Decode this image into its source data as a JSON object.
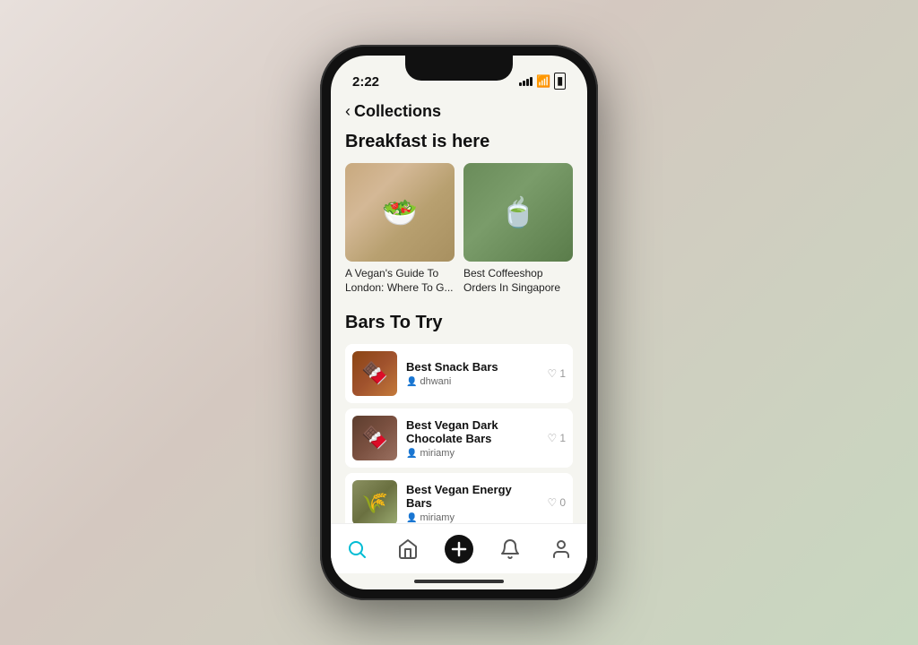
{
  "phone": {
    "status": {
      "time": "2:22",
      "signal": true,
      "wifi": true,
      "battery": true
    },
    "header": {
      "back_label": "Collections",
      "back_icon": "‹"
    },
    "sections": [
      {
        "id": "breakfast",
        "title": "Breakfast is here",
        "type": "grid",
        "items": [
          {
            "id": "vegan-london",
            "image_type": "vegan",
            "label": "A Vegan's Guide To London: Where To G..."
          },
          {
            "id": "coffeeshop-sg",
            "image_type": "coffee",
            "label": "Best Coffeeshop Orders In Singapore"
          }
        ]
      },
      {
        "id": "bars",
        "title": "Bars To Try",
        "type": "list",
        "items": [
          {
            "id": "snack-bars",
            "image_type": "snack",
            "title": "Best Snack Bars",
            "author": "dhwani",
            "likes": 1
          },
          {
            "id": "dark-choc-bars",
            "image_type": "dark-choc",
            "title": "Best Vegan Dark Chocolate Bars",
            "author": "miriamy",
            "likes": 1
          },
          {
            "id": "energy-bars",
            "image_type": "energy",
            "title": "Best Vegan Energy Bars",
            "author": "miriamy",
            "likes": 0
          }
        ]
      }
    ],
    "tab_bar": {
      "tabs": [
        {
          "id": "search",
          "icon": "search",
          "active": true
        },
        {
          "id": "home",
          "icon": "home",
          "active": false
        },
        {
          "id": "add",
          "icon": "plus",
          "active": false
        },
        {
          "id": "notifications",
          "icon": "bell",
          "active": false
        },
        {
          "id": "profile",
          "icon": "user",
          "active": false
        }
      ]
    }
  }
}
